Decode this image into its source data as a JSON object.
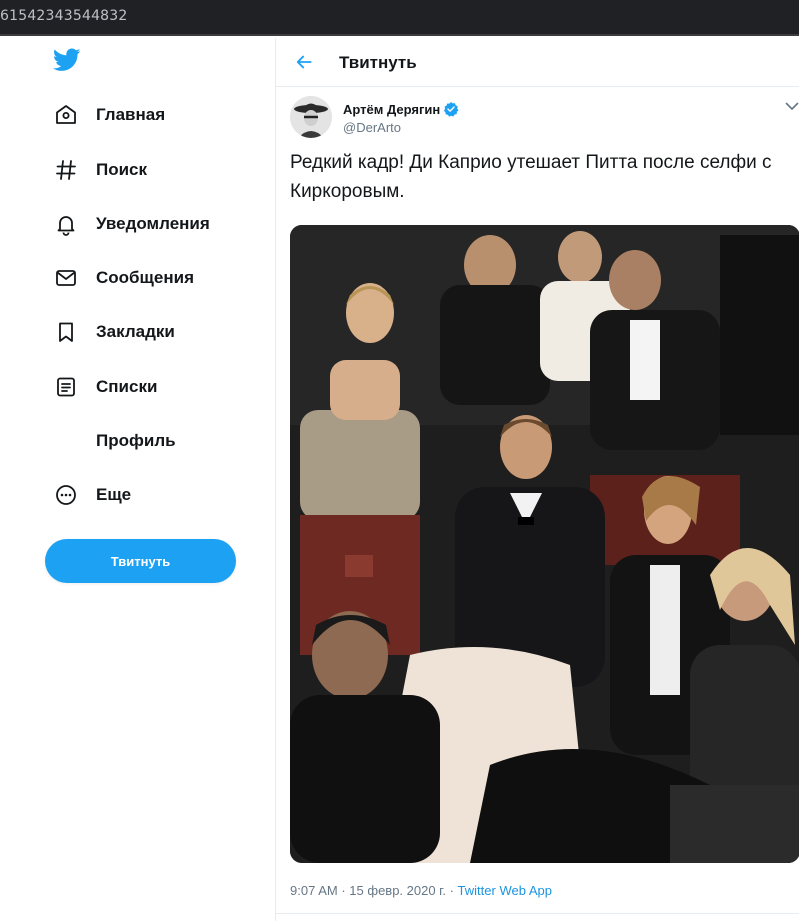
{
  "browser": {
    "url_fragment": "61542343544832"
  },
  "sidebar": {
    "logo_icon": "twitter-bird-icon",
    "items": [
      {
        "label": "Главная",
        "icon": "home-icon"
      },
      {
        "label": "Поиск",
        "icon": "hashtag-icon"
      },
      {
        "label": "Уведомления",
        "icon": "bell-icon"
      },
      {
        "label": "Сообщения",
        "icon": "envelope-icon"
      },
      {
        "label": "Закладки",
        "icon": "bookmark-icon"
      },
      {
        "label": "Списки",
        "icon": "list-icon"
      },
      {
        "label": "Профиль",
        "icon": ""
      },
      {
        "label": "Еще",
        "icon": "more-circle-icon"
      }
    ],
    "tweet_button_label": "Твитнуть"
  },
  "header": {
    "title": "Твитнуть",
    "back_icon": "arrow-left-icon"
  },
  "tweet": {
    "author_name": "Артём Дерягин",
    "verified": true,
    "handle": "@DerArto",
    "text": "Редкий кадр! Ди Каприо утешает Питта после селфи с Киркоровым.",
    "time": "9:07 AM",
    "date": "15 февр. 2020 г.",
    "separator": "·",
    "app": "Twitter Web App"
  },
  "colors": {
    "accent": "#1da1f2",
    "secondary_text": "#657786",
    "link": "#1b95e0"
  }
}
